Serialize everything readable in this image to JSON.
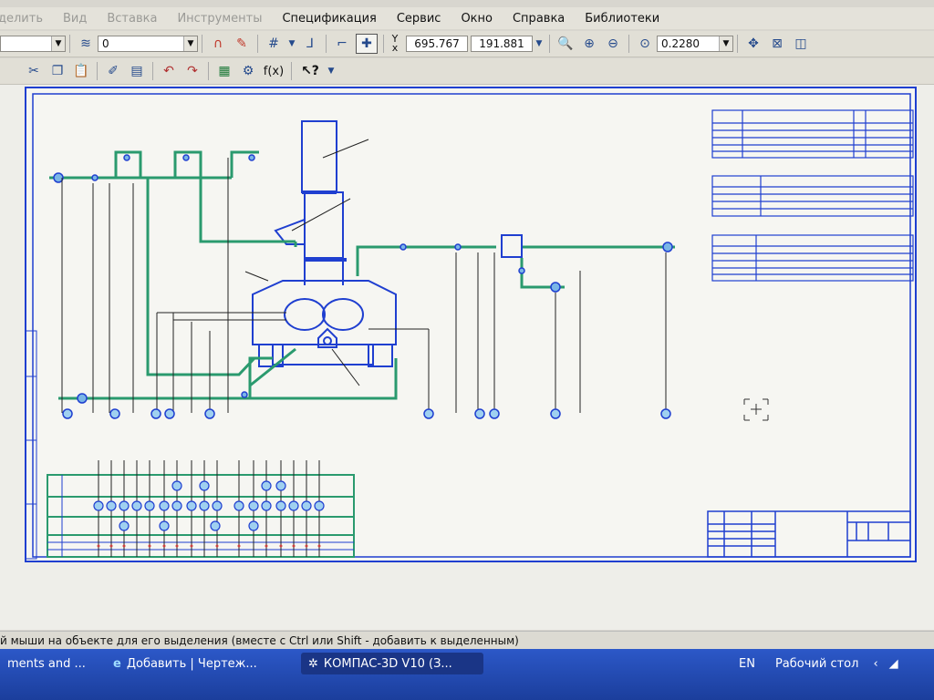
{
  "menu": {
    "items": [
      "Выделить",
      "Вид",
      "Вставка",
      "Инструменты",
      "Спецификация",
      "Сервис",
      "Окно",
      "Справка",
      "Библиотеки"
    ],
    "partial_first": "делить"
  },
  "toolbar1": {
    "style_value": "",
    "layer_value": "0",
    "coord_x": "695.767",
    "coord_y": "191.881",
    "zoom_value": "0.2280",
    "coord_label_y": "Y",
    "coord_label_x": "x"
  },
  "toolbar2": {
    "fx_label": "f(x)",
    "help_label": "?"
  },
  "status": {
    "hint": "й мыши на объекте для его выделения (вместе с Ctrl или Shift - добавить к выделенным)"
  },
  "taskbar": {
    "task1": "ments and ...",
    "task2": "Добавить | Чертеж...",
    "task3": "КОМПАС-3D V10 (З...",
    "lang": "EN",
    "desktop": "Рабочий стол"
  },
  "colors": {
    "frame": "#1f3fd0",
    "pipe": "#2a9a6e",
    "line": "#222222",
    "taskbar": "#2450b8"
  }
}
